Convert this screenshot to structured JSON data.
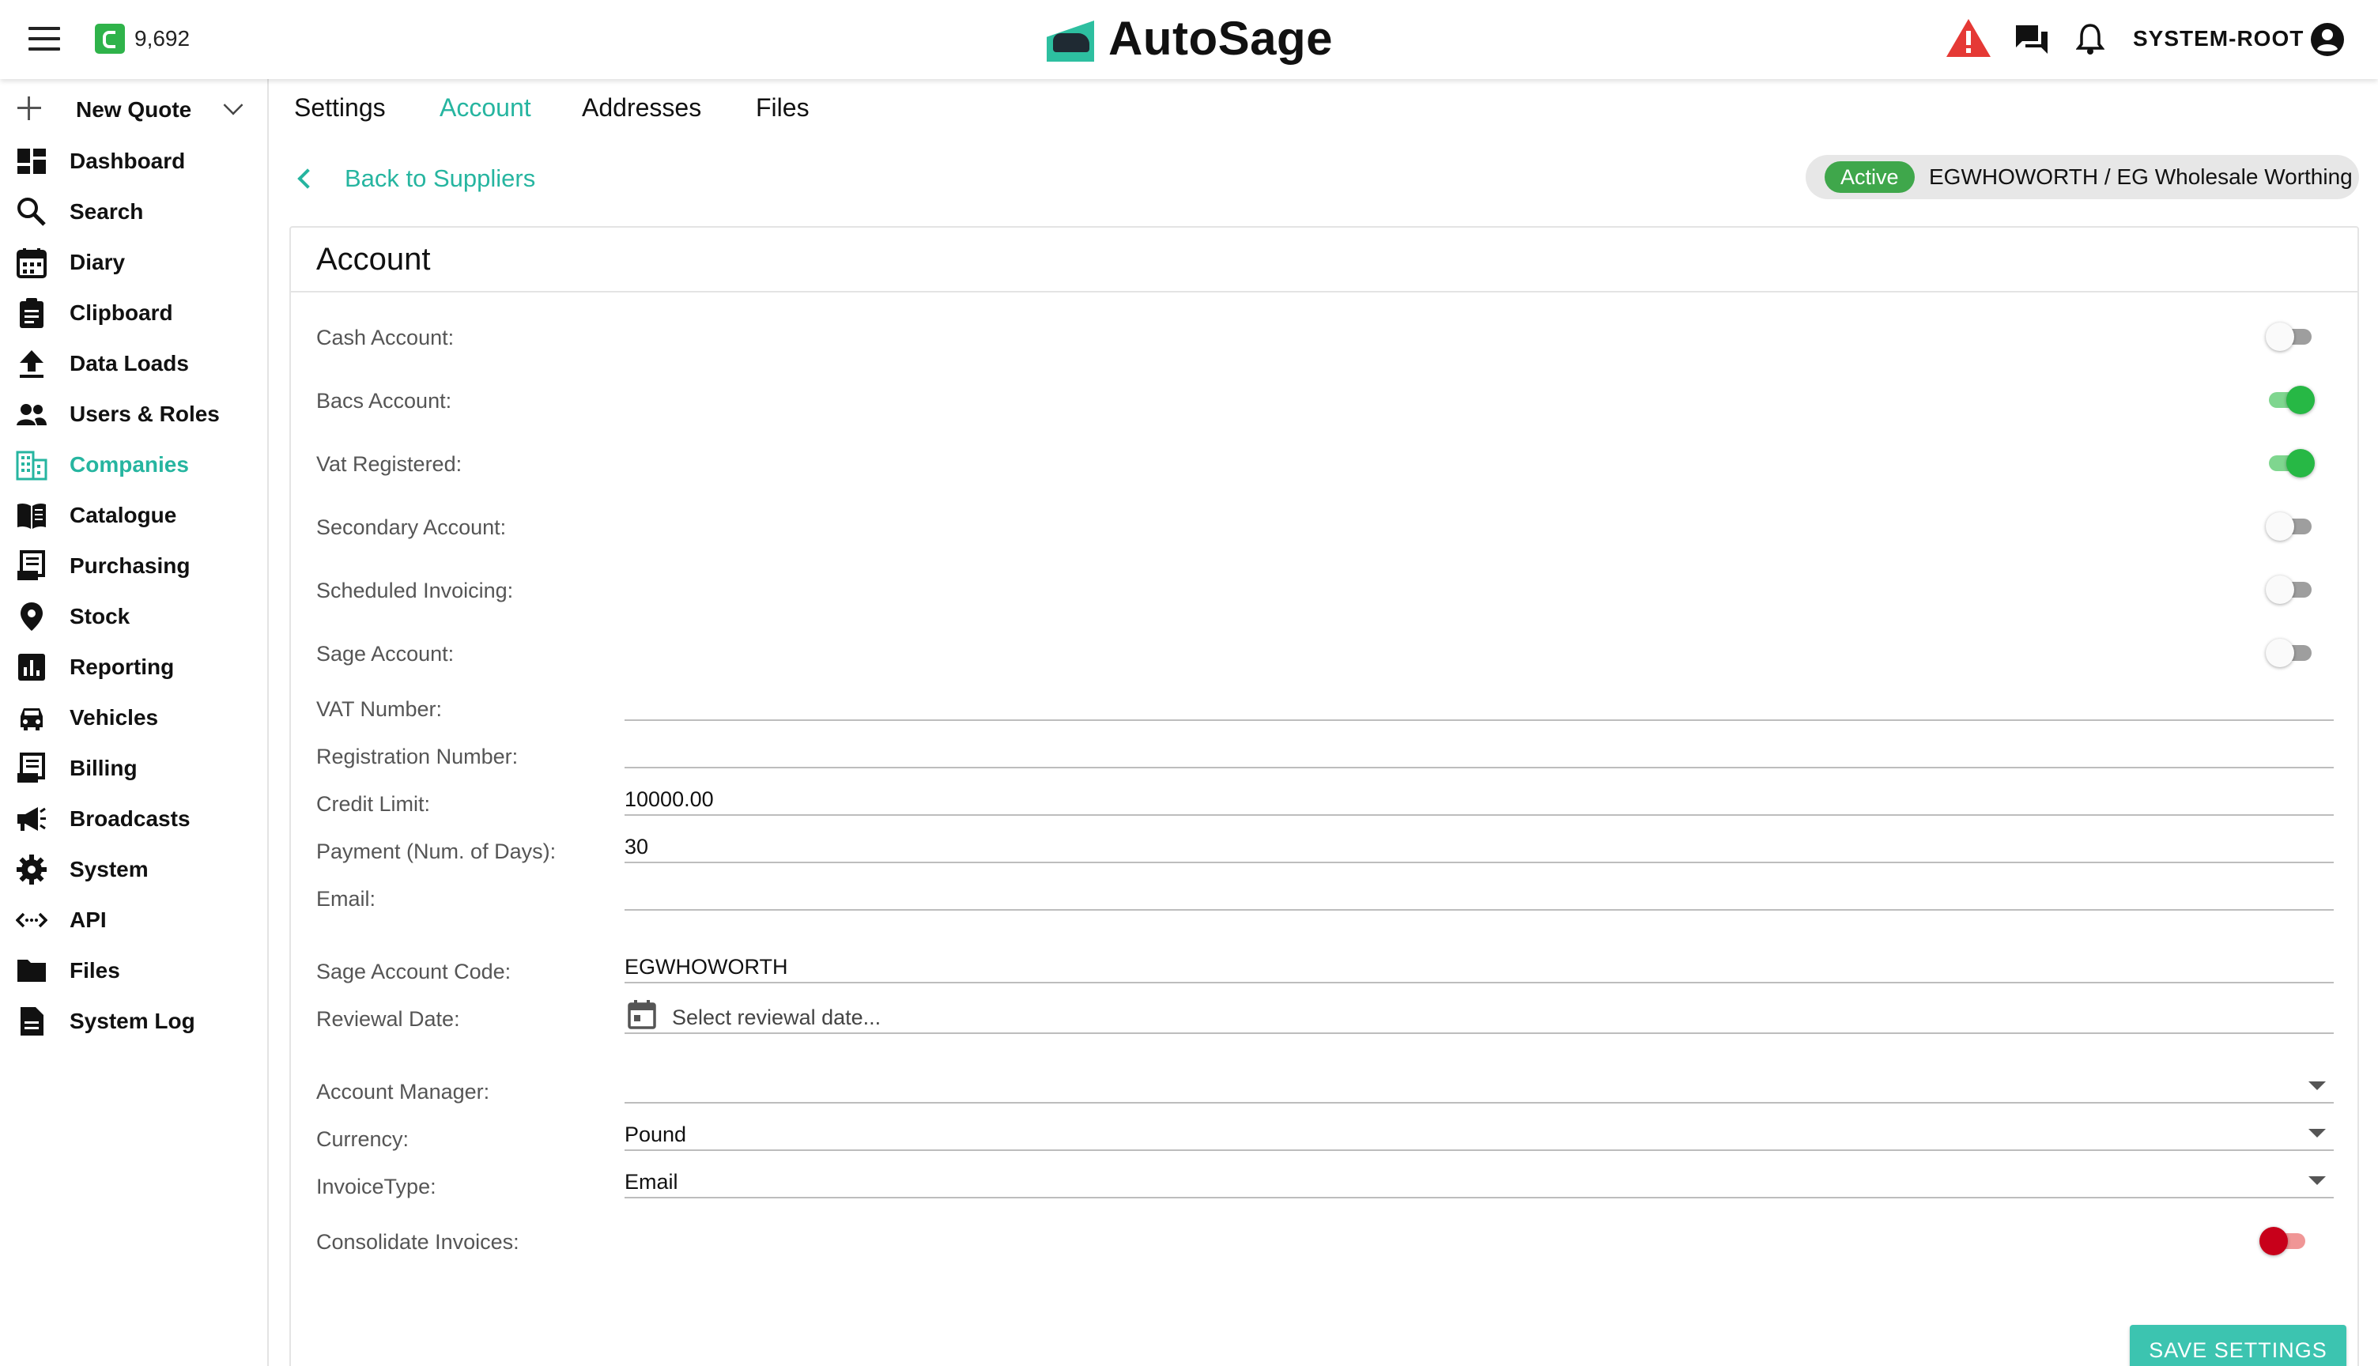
{
  "header": {
    "credit_value": "9,692",
    "app_name": "AutoSage",
    "user_name": "SYSTEM-ROOT"
  },
  "sidebar": {
    "new_quote": "New Quote",
    "items": [
      {
        "label": "Dashboard",
        "icon": "dashboard-icon"
      },
      {
        "label": "Search",
        "icon": "search-icon"
      },
      {
        "label": "Diary",
        "icon": "calendar-icon"
      },
      {
        "label": "Clipboard",
        "icon": "clipboard-icon"
      },
      {
        "label": "Data Loads",
        "icon": "upload-icon"
      },
      {
        "label": "Users & Roles",
        "icon": "people-icon"
      },
      {
        "label": "Companies",
        "icon": "building-icon"
      },
      {
        "label": "Catalogue",
        "icon": "book-icon"
      },
      {
        "label": "Purchasing",
        "icon": "receipt-icon"
      },
      {
        "label": "Stock",
        "icon": "location-pin-icon"
      },
      {
        "label": "Reporting",
        "icon": "chart-icon"
      },
      {
        "label": "Vehicles",
        "icon": "car-icon"
      },
      {
        "label": "Billing",
        "icon": "invoice-icon"
      },
      {
        "label": "Broadcasts",
        "icon": "megaphone-icon"
      },
      {
        "label": "System",
        "icon": "gear-icon"
      },
      {
        "label": "API",
        "icon": "code-icon"
      },
      {
        "label": "Files",
        "icon": "folder-icon"
      },
      {
        "label": "System Log",
        "icon": "document-icon"
      }
    ],
    "active": "Companies"
  },
  "tabs": [
    "Settings",
    "Account",
    "Addresses",
    "Files"
  ],
  "active_tab": "Account",
  "back_link": "Back to Suppliers",
  "status": {
    "badge": "Active",
    "name": "EGWHOWORTH / EG Wholesale Worthing"
  },
  "panel": {
    "title": "Account",
    "toggles": {
      "cash_account": {
        "label": "Cash Account:",
        "on": false
      },
      "bacs_account": {
        "label": "Bacs Account:",
        "on": true
      },
      "vat_registered": {
        "label": "Vat Registered:",
        "on": true
      },
      "secondary_account": {
        "label": "Secondary Account:",
        "on": false
      },
      "scheduled_invoicing": {
        "label": "Scheduled Invoicing:",
        "on": false
      },
      "sage_account": {
        "label": "Sage Account:",
        "on": false
      }
    },
    "fields": {
      "vat_number": {
        "label": "VAT Number:",
        "value": ""
      },
      "registration_number": {
        "label": "Registration Number:",
        "value": ""
      },
      "credit_limit": {
        "label": "Credit Limit:",
        "value": "10000.00"
      },
      "payment_days": {
        "label": "Payment (Num. of Days):",
        "value": "30"
      },
      "email": {
        "label": "Email:",
        "value": ""
      },
      "sage_account_code": {
        "label": "Sage Account Code:",
        "value": "EGWHOWORTH"
      },
      "reviewal_date": {
        "label": "Reviewal Date:",
        "placeholder": "Select reviewal date..."
      },
      "account_manager": {
        "label": "Account Manager:",
        "value": ""
      },
      "currency": {
        "label": "Currency:",
        "value": "Pound"
      },
      "invoice_type": {
        "label": "InvoiceType:",
        "value": "Email"
      }
    },
    "consolidate_invoices": {
      "label": "Consolidate Invoices:",
      "on": false,
      "color": "#c8001a"
    },
    "save_label": "SAVE SETTINGS"
  },
  "colors": {
    "accent": "#26b5a0",
    "on_green": "#27b845",
    "active_badge": "#3fa74b",
    "warning": "#e53935"
  }
}
